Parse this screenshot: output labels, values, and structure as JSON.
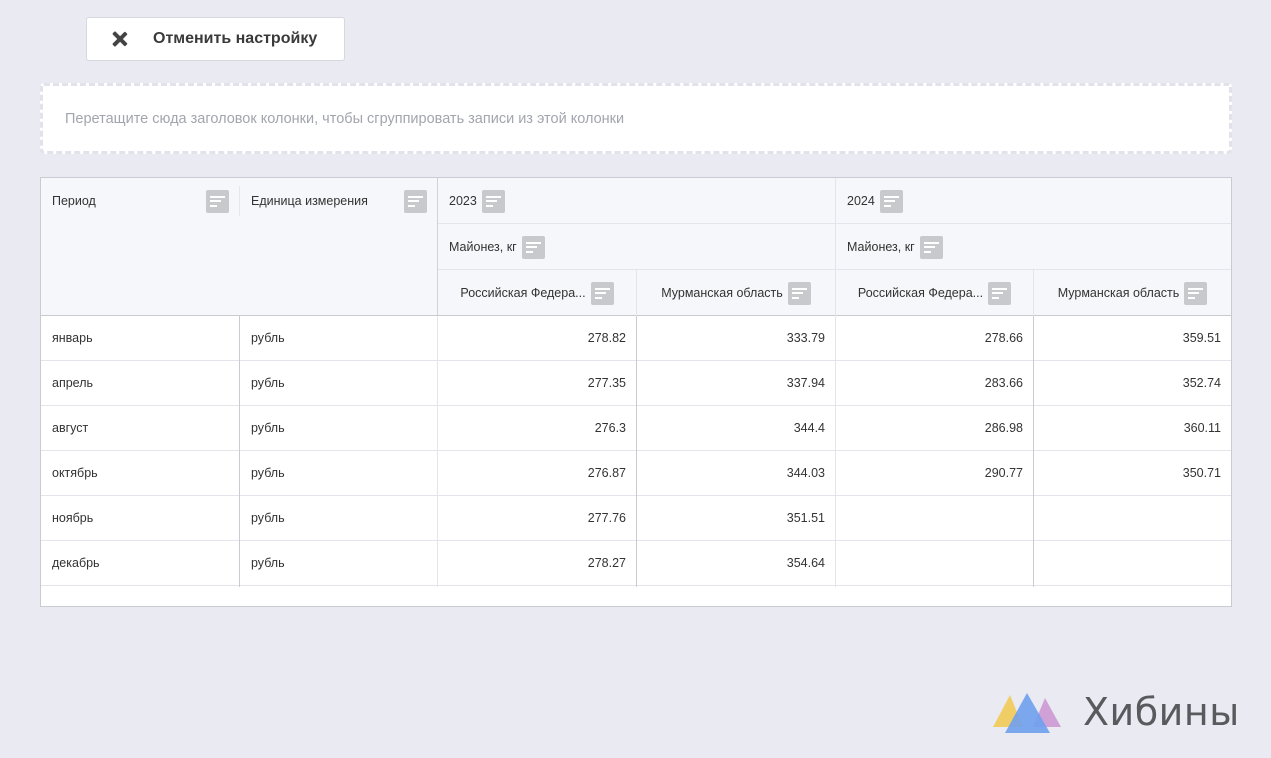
{
  "toolbar": {
    "reset_label": "Отменить настройку"
  },
  "group_zone": {
    "hint": "Перетащите сюда заголовок колонки, чтобы сгруппировать записи из этой колонки"
  },
  "grid": {
    "columns": {
      "period": "Период",
      "unit": "Единица измерения",
      "year1": "2023",
      "year2": "2024",
      "product1": "Майонез, кг",
      "product2": "Майонез, кг",
      "region1": "Российская Федера...",
      "region2": "Мурманская область",
      "region3": "Российская Федера...",
      "region4": "Мурманская область"
    },
    "rows": [
      {
        "period": "январь",
        "unit": "рубль",
        "v1": "278.82",
        "v2": "333.79",
        "v3": "278.66",
        "v4": "359.51"
      },
      {
        "period": "апрель",
        "unit": "рубль",
        "v1": "277.35",
        "v2": "337.94",
        "v3": "283.66",
        "v4": "352.74"
      },
      {
        "period": "август",
        "unit": "рубль",
        "v1": "276.3",
        "v2": "344.4",
        "v3": "286.98",
        "v4": "360.11"
      },
      {
        "period": "октябрь",
        "unit": "рубль",
        "v1": "276.87",
        "v2": "344.03",
        "v3": "290.77",
        "v4": "350.71"
      },
      {
        "period": "ноябрь",
        "unit": "рубль",
        "v1": "277.76",
        "v2": "351.51",
        "v3": "",
        "v4": ""
      },
      {
        "period": "декабрь",
        "unit": "рубль",
        "v1": "278.27",
        "v2": "354.64",
        "v3": "",
        "v4": ""
      }
    ]
  },
  "logo": {
    "brand": "Хибины",
    "colors": [
      "#f2c94c",
      "#6fa0ee",
      "#c98fd0"
    ]
  }
}
